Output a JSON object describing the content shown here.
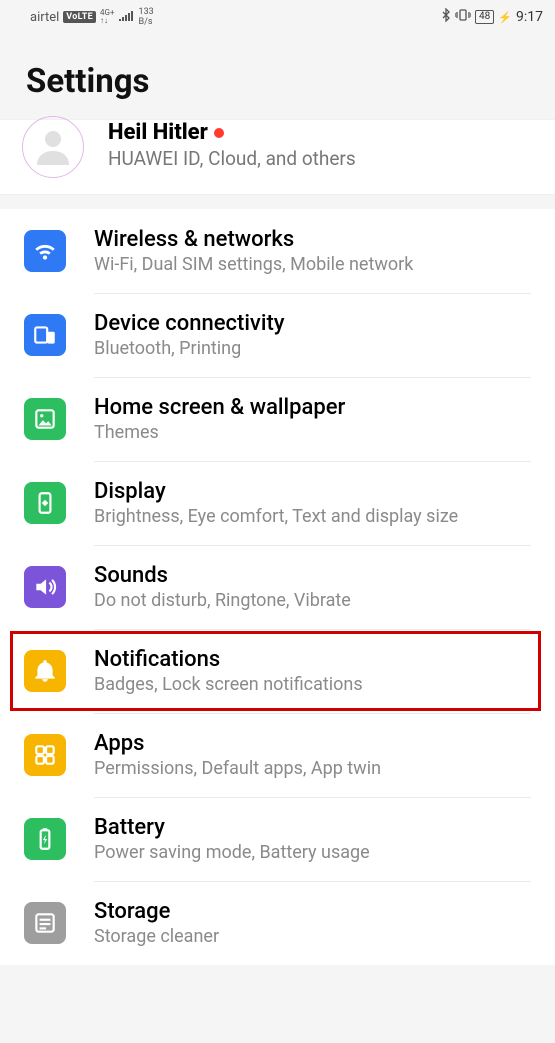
{
  "status": {
    "carrier": "airtel",
    "volte": "VoLTE",
    "net_top": "4G+",
    "net_bottom": "↑↓",
    "data_rate": "133",
    "data_unit": "B/s",
    "battery": "48",
    "clock": "9:17"
  },
  "header": {
    "title": "Settings"
  },
  "account": {
    "name": "Heil Hitler",
    "subtitle": "HUAWEI ID, Cloud, and others"
  },
  "rows": {
    "wireless": {
      "title": "Wireless & networks",
      "sub": "Wi-Fi, Dual SIM settings, Mobile network"
    },
    "device": {
      "title": "Device connectivity",
      "sub": "Bluetooth, Printing"
    },
    "home": {
      "title": "Home screen & wallpaper",
      "sub": "Themes"
    },
    "display": {
      "title": "Display",
      "sub": "Brightness, Eye comfort, Text and display size"
    },
    "sounds": {
      "title": "Sounds",
      "sub": "Do not disturb, Ringtone, Vibrate"
    },
    "notif": {
      "title": "Notifications",
      "sub": "Badges, Lock screen notifications"
    },
    "apps": {
      "title": "Apps",
      "sub": "Permissions, Default apps, App twin"
    },
    "battery": {
      "title": "Battery",
      "sub": "Power saving mode, Battery usage"
    },
    "storage": {
      "title": "Storage",
      "sub": "Storage cleaner"
    }
  },
  "colors": {
    "highlight": "#d10000"
  }
}
